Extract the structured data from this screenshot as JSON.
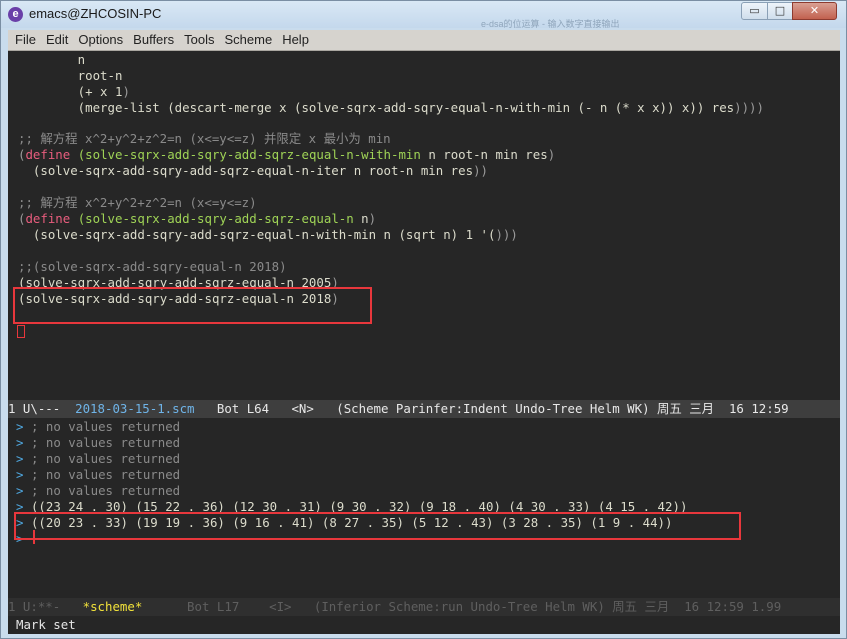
{
  "window": {
    "title": "emacs@ZHCOSIN-PC",
    "app_icon": "emacs-icon",
    "faint_title": "e-dsa的位运算 - 输入数字直接输出",
    "controls": {
      "minimize": "▭",
      "maximize": "□",
      "close": "✕"
    }
  },
  "menu": [
    "File",
    "Edit",
    "Options",
    "Buffers",
    "Tools",
    "Scheme",
    "Help"
  ],
  "editor": {
    "l1": "        n",
    "l2": "        root-n",
    "l3a": "        (+ x 1",
    "l3b": ")",
    "l4a": "        (merge-list (descart-merge x (solve-sqrx-add-sqry-equal-n-with-min (- n (* x x)) x)) res",
    "l4b": "))))",
    "c1": ";; 解方程 x^2+y^2+z^2=n (x<=y<=z) 并限定 x 最小为 min",
    "d1_open": "(",
    "d1_kw": "define",
    "d1_fn": " (solve-sqrx-add-sqry-add-sqrz-equal-n-with-min",
    "d1_rest": " n root-n min res",
    "d1_close": ")",
    "d2": "  (solve-sqrx-add-sqry-add-sqrz-equal-n-iter n root-n min res",
    "d2_close": "))",
    "c2": ";; 解方程 x^2+y^2+z^2=n (x<=y<=z)",
    "e1_open": "(",
    "e1_kw": "define",
    "e1_fn": " (solve-sqrx-add-sqry-add-sqrz-equal-n",
    "e1_rest": " n",
    "e1_close": ")",
    "e2": "  (solve-sqrx-add-sqry-add-sqrz-equal-n-with-min n (sqrt n) 1 '(",
    "e2_close": ")))",
    "c3": ";;(solve-sqrx-add-sqry-equal-n 2018)",
    "s1": "(solve-sqrx-add-sqry-add-sqrz-equal-n 2005",
    "s1_close": ")",
    "s2": "(solve-sqrx-add-sqry-add-sqrz-equal-n 2018",
    "s2_close": ")"
  },
  "modeline_top": {
    "prefix": "1 U\\---  ",
    "filename": "2018-03-15-1.scm",
    "rest": "   Bot L64   <N>   (Scheme Parinfer:Indent Undo-Tree Helm WK) 周五 三月  16 12:59"
  },
  "repl": {
    "prompt": ">",
    "no_values": "; no values returned",
    "result1": "((23 24 . 30) (15 22 . 36) (12 30 . 31) (9 30 . 32) (9 18 . 40) (4 30 . 33) (4 15 . 42))",
    "result2": "((20 23 . 33) (19 19 . 36) (9 16 . 41) (8 27 . 35) (5 12 . 43) (3 28 . 35) (1 9 . 44))"
  },
  "modeline_bottom": {
    "prefix": "1 U:**-   ",
    "buffer": "*scheme*",
    "rest": "      Bot L17    <I>   (Inferior Scheme:run Undo-Tree Helm WK) 周五 三月  16 12:59 1.99"
  },
  "echo": "Mark set"
}
